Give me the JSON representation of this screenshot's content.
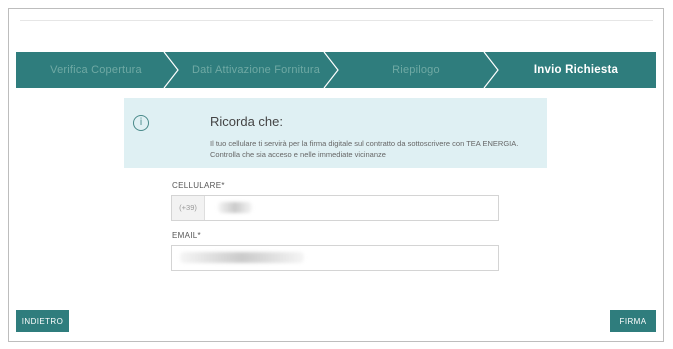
{
  "stepper": {
    "steps": [
      {
        "label": "Verifica Copertura",
        "active": false
      },
      {
        "label": "Dati Attivazione Fornitura",
        "active": false
      },
      {
        "label": "Riepilogo",
        "active": false
      },
      {
        "label": "Invio Richiesta",
        "active": true
      }
    ]
  },
  "notice": {
    "icon": "info-icon",
    "title": "Ricorda che:",
    "line1": "Il tuo cellulare ti servirà per la firma digitale sul contratto da sottoscrivere con TEA ENERGIA.",
    "line2": "Controlla che sia acceso e nelle immediate vicinanze"
  },
  "form": {
    "phone_label": "CELLULARE*",
    "phone_prefix": "(+39)",
    "email_label": "EMAIL*"
  },
  "buttons": {
    "back": "INDIETRO",
    "sign": "FIRMA"
  },
  "colors": {
    "primary": "#2f7d7d",
    "notice_bg": "#dff0f3"
  }
}
